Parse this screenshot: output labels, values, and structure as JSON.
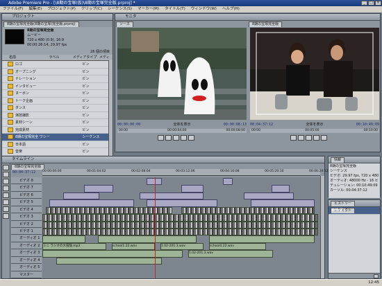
{
  "app": {
    "title": "Adobe Premiere Pro - [\\8期の宝塚(仮)\\8期の宝塚完全版.prproj] *"
  },
  "menu": [
    "ファイル(F)",
    "編集(E)",
    "プロジェクト(P)",
    "クリップ(C)",
    "シーケンス(S)",
    "マーカー(M)",
    "タイトル(T)",
    "ウィンドウ(W)",
    "ヘルプ(H)"
  ],
  "project": {
    "panel_title": "プロジェクト",
    "tab": "8期の宝塚完全版(8期の宝塚(完全版.prproj)",
    "clip_name": "8期の宝塚完全版",
    "clip_info": [
      "ムービー",
      "720 x 480 (0.9), 16:9",
      "00:00:26:14, 29.97 fps",
      "00:01:10:35 29.97 fps"
    ],
    "item_count": "26 個の項目",
    "columns": [
      "名前",
      "ラベル",
      "メディアタイプ",
      "メディ"
    ],
    "rows": [
      {
        "name": "ロゴ",
        "type": "ビン"
      },
      {
        "name": "オープニング",
        "type": "ビン"
      },
      {
        "name": "ナレーション",
        "type": "ビン"
      },
      {
        "name": "インタビュー",
        "type": "ビン"
      },
      {
        "name": "ヌーボン",
        "type": "ビン"
      },
      {
        "name": "トーク企画",
        "type": "ビン"
      },
      {
        "name": "ダンス",
        "type": "ビン"
      },
      {
        "name": "演技撮影",
        "type": "ビン"
      },
      {
        "name": "素材シーン",
        "type": "ビン"
      },
      {
        "name": "完成素材",
        "type": "ビン"
      },
      {
        "name": "8期の宝塚完全 ワシーケンス",
        "type": "シーケンス"
      },
      {
        "name": "日本語",
        "type": "ビン"
      },
      {
        "name": "音楽",
        "type": "ビン"
      },
      {
        "name": "効果音素材",
        "type": "ビン"
      },
      {
        "name": "写真",
        "type": "ビン"
      },
      {
        "name": "文字",
        "type": "ビン"
      },
      {
        "name": "未使用",
        "type": "ビン"
      }
    ]
  },
  "monitor": {
    "panel_title": "モニタ",
    "source_tab": "ソース",
    "program_tab": "8期の宝塚完全版",
    "source_tc_left": "00:00:00:00",
    "source_label": "全体を表示",
    "source_tc_right": "00:00:08:13",
    "program_tc_left": "00:04:37:12",
    "program_label": "全体を表示",
    "program_tc_right": "00:10:49:09",
    "ruler_left": [
      "00:00",
      "00:00:04:00",
      "00:00:08:00"
    ],
    "ruler_right": [
      "00:00",
      "00:05:00",
      "00:10:00"
    ]
  },
  "timeline": {
    "panel_title": "タイムライン",
    "tab": "8期の宝塚完全版",
    "current_tc": "00:04:37:12",
    "ruler": [
      "00:00:00:00",
      "00:01:04:02",
      "00:02:08:04",
      "00:03:12:06",
      "00:04:16:08",
      "00:05:20:10",
      "00:06:24:12"
    ],
    "video_tracks": [
      "ビデオ 8",
      "ビデオ 7",
      "ビデオ 6",
      "ビデオ 5",
      "ビデオ 4",
      "ビデオ 3",
      "ビデオ 2",
      "ビデオ 1"
    ],
    "audio_tracks": [
      "オーディオ 1",
      "オーディオ 2",
      "オーディオ 3",
      "オーディオ 4",
      "オーディオ 5",
      "マスター"
    ],
    "audio_clip_labels": [
      "ミニ ラジオの大冒険.mp3",
      "school1.22.wav",
      "1.02-201.3.wav",
      "school4.22.wav",
      "1.02-201.3.wav"
    ]
  },
  "info": {
    "tab": "情報",
    "tab2": "ヒストリー",
    "lines": [
      "8期の宝塚完全版",
      "シーケンス",
      "ビデオ: 29.97 fps, 720 x 480 (0.9)",
      "オーディオ: 48000 Hz - 16 ビット - ステレオ",
      "デュレーション: 00:10:49:09",
      "",
      "カーソル: 00:04:37:12",
      "",
      "開始: 00:00:00:00",
      "終了: 00:10:49:08"
    ],
    "history_tab": "ヒストリー",
    "effects_tab": "エフェクト",
    "history_item": "新規/開く"
  },
  "taskbar": {
    "clock": "12:45"
  },
  "colors": {
    "accent": "#1b2a70",
    "title_bar": "#183a7c",
    "playhead": "#d02020"
  }
}
